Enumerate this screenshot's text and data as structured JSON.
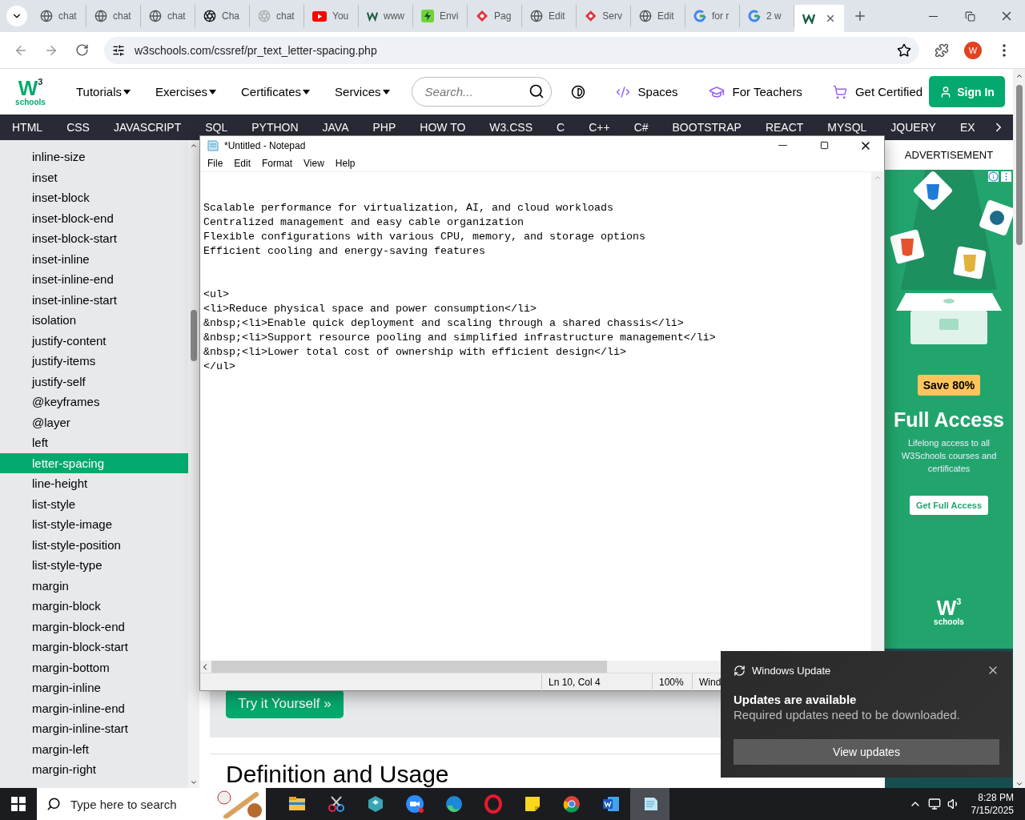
{
  "browser": {
    "tabs": [
      {
        "label": "chat",
        "kind": "globe",
        "selected": false
      },
      {
        "label": "chat",
        "kind": "globe",
        "selected": false
      },
      {
        "label": "chat",
        "kind": "globe",
        "selected": false
      },
      {
        "label": "Cha",
        "kind": "aperture",
        "selected": false
      },
      {
        "label": "chat",
        "kind": "faded",
        "selected": false
      },
      {
        "label": "You",
        "kind": "play",
        "selected": false
      },
      {
        "label": "www",
        "kind": "zigzag",
        "selected": false
      },
      {
        "label": "Envi",
        "kind": "bolt",
        "selected": false
      },
      {
        "label": "Pag",
        "kind": "diamond",
        "selected": false
      },
      {
        "label": "Edit",
        "kind": "globe",
        "selected": false
      },
      {
        "label": "Serv",
        "kind": "diamond",
        "selected": false
      },
      {
        "label": "Edit",
        "kind": "globe",
        "selected": false
      },
      {
        "label": "for r",
        "kind": "ring",
        "selected": false
      },
      {
        "label": "2 w",
        "kind": "ring",
        "selected": false
      },
      {
        "kind": "zigzag",
        "selected": true
      }
    ],
    "url": "w3schools.com/cssref/pr_text_letter-spacing.php",
    "profile": "W"
  },
  "site": {
    "logo": {
      "mark": "W",
      "sup": "3",
      "word": "schools"
    },
    "menus": [
      "Tutorials",
      "Exercises",
      "Certificates",
      "Services"
    ],
    "search": {
      "placeholder": "Search..."
    },
    "links": [
      {
        "label": "Spaces",
        "kind": "code"
      },
      {
        "label": "For Teachers",
        "kind": "cap"
      },
      {
        "label": "Get Certified",
        "kind": "cart"
      }
    ],
    "sign_in": "Sign In",
    "topnav": [
      "HTML",
      "CSS",
      "JAVASCRIPT",
      "SQL",
      "PYTHON",
      "JAVA",
      "PHP",
      "HOW TO",
      "W3.CSS",
      "C",
      "C++",
      "C#",
      "BOOTSTRAP",
      "REACT",
      "MYSQL",
      "JQUERY",
      "EX"
    ],
    "sidebar": [
      {
        "label": "inline-size",
        "selected": false
      },
      {
        "label": "inset",
        "selected": false
      },
      {
        "label": "inset-block",
        "selected": false
      },
      {
        "label": "inset-block-end",
        "selected": false
      },
      {
        "label": "inset-block-start",
        "selected": false
      },
      {
        "label": "inset-inline",
        "selected": false
      },
      {
        "label": "inset-inline-end",
        "selected": false
      },
      {
        "label": "inset-inline-start",
        "selected": false
      },
      {
        "label": "isolation",
        "selected": false
      },
      {
        "label": "justify-content",
        "selected": false
      },
      {
        "label": "justify-items",
        "selected": false
      },
      {
        "label": "justify-self",
        "selected": false
      },
      {
        "label": "@keyframes",
        "selected": false
      },
      {
        "label": "@layer",
        "selected": false
      },
      {
        "label": "left",
        "selected": false
      },
      {
        "label": "letter-spacing",
        "selected": true
      },
      {
        "label": "line-height",
        "selected": false
      },
      {
        "label": "list-style",
        "selected": false
      },
      {
        "label": "list-style-image",
        "selected": false
      },
      {
        "label": "list-style-position",
        "selected": false
      },
      {
        "label": "list-style-type",
        "selected": false
      },
      {
        "label": "margin",
        "selected": false
      },
      {
        "label": "margin-block",
        "selected": false
      },
      {
        "label": "margin-block-end",
        "selected": false
      },
      {
        "label": "margin-block-start",
        "selected": false
      },
      {
        "label": "margin-bottom",
        "selected": false
      },
      {
        "label": "margin-inline",
        "selected": false
      },
      {
        "label": "margin-inline-end",
        "selected": false
      },
      {
        "label": "margin-inline-start",
        "selected": false
      },
      {
        "label": "margin-left",
        "selected": false
      },
      {
        "label": "margin-right",
        "selected": false
      }
    ],
    "try_button": "Try it Yourself »",
    "heading": "Definition and Usage",
    "ad": {
      "label": "ADVERTISEMENT",
      "badge": "Save 80%",
      "title": "Full Access",
      "text": "Lifelong access to all W3Schools courses and certificates",
      "button": "Get Full Access",
      "logo": {
        "mark": "W",
        "sup": "3",
        "word": "schools"
      }
    }
  },
  "notepad": {
    "title": "*Untitled - Notepad",
    "menu": [
      "File",
      "Edit",
      "Format",
      "View",
      "Help"
    ],
    "text": "\n\nScalable performance for virtualization, AI, and cloud workloads\nCentralized management and easy cable organization\nFlexible configurations with various CPU, memory, and storage options\nEfficient cooling and energy-saving features\n\n\n<ul>\n<li>Reduce physical space and power consumption</li>\n&nbsp;<li>Enable quick deployment and scaling through a shared chassis</li>\n&nbsp;<li>Support resource pooling and simplified infrastructure management</li>\n&nbsp;<li>Lower total cost of ownership with efficient design</li>\n</ul>",
    "status": [
      "Ln 10, Col 4",
      "100%",
      "Wind"
    ]
  },
  "toast": {
    "app": "Windows Update",
    "title": "Updates are available",
    "message": "Required updates need to be downloaded.",
    "button": "View updates"
  },
  "taskbar": {
    "search_placeholder": "Type here to search",
    "apps": [
      {
        "kind": "folder",
        "selected": false
      },
      {
        "kind": "scissors",
        "selected": false
      },
      {
        "kind": "cube",
        "selected": false
      },
      {
        "kind": "camera",
        "selected": false
      },
      {
        "kind": "swirl",
        "selected": false
      },
      {
        "kind": "ring",
        "selected": false
      },
      {
        "kind": "note",
        "selected": false
      },
      {
        "kind": "wheel",
        "selected": false
      },
      {
        "kind": "document",
        "selected": false
      },
      {
        "kind": "notepad",
        "selected": true
      }
    ],
    "time": "8:28 PM",
    "date": "7/15/2025"
  }
}
